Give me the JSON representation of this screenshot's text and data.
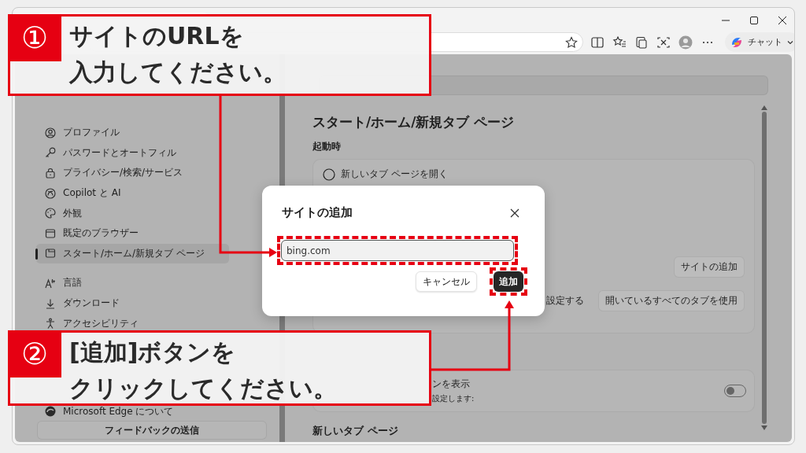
{
  "toolbar": {
    "chat_button": "チャット"
  },
  "sidebar": {
    "items": [
      {
        "label": "プロファイル",
        "selected": false
      },
      {
        "label": "パスワードとオートフィル",
        "selected": false
      },
      {
        "label": "プライバシー/検索/サービス",
        "selected": false
      },
      {
        "label": "Copilot と AI",
        "selected": false
      },
      {
        "label": "外観",
        "selected": false
      },
      {
        "label": "既定のブラウザー",
        "selected": false
      },
      {
        "label": "スタート/ホーム/新規タブ ページ",
        "selected": true
      },
      {
        "label": "言語",
        "selected": false
      },
      {
        "label": "ダウンロード",
        "selected": false
      },
      {
        "label": "アクセシビリティ",
        "selected": false
      }
    ],
    "about": "Microsoft Edge について",
    "feedback_button": "フィードバックの送信"
  },
  "main": {
    "heading": "スタート/ホーム/新規タブ ページ",
    "startup": {
      "label": "起動時",
      "options": [
        {
          "label": "新しいタブ ページを開く",
          "selected": false
        }
      ],
      "add_site_button": "サイトの追加",
      "partial_text": "設定する",
      "use_open_tabs_button": "開いているすべてのタブを使用"
    },
    "home_button": {
      "title_fragment": "ンを表示",
      "description_fragment": "設定します:",
      "on": false
    },
    "new_tab_heading": "新しいタブ ページ"
  },
  "dialog": {
    "title": "サイトの追加",
    "url_field": {
      "value": "bing.com",
      "highlighted": true
    },
    "buttons": [
      {
        "label": "キャンセル",
        "kind": "secondary",
        "highlighted": false
      },
      {
        "label": "追加",
        "kind": "primary",
        "highlighted": true
      }
    ]
  },
  "callouts": [
    {
      "number": "①",
      "lines": [
        "サイトのURLを",
        "入力してください。"
      ]
    },
    {
      "number": "②",
      "lines": [
        "[追加]ボタンを",
        "クリックしてください。"
      ]
    }
  ]
}
